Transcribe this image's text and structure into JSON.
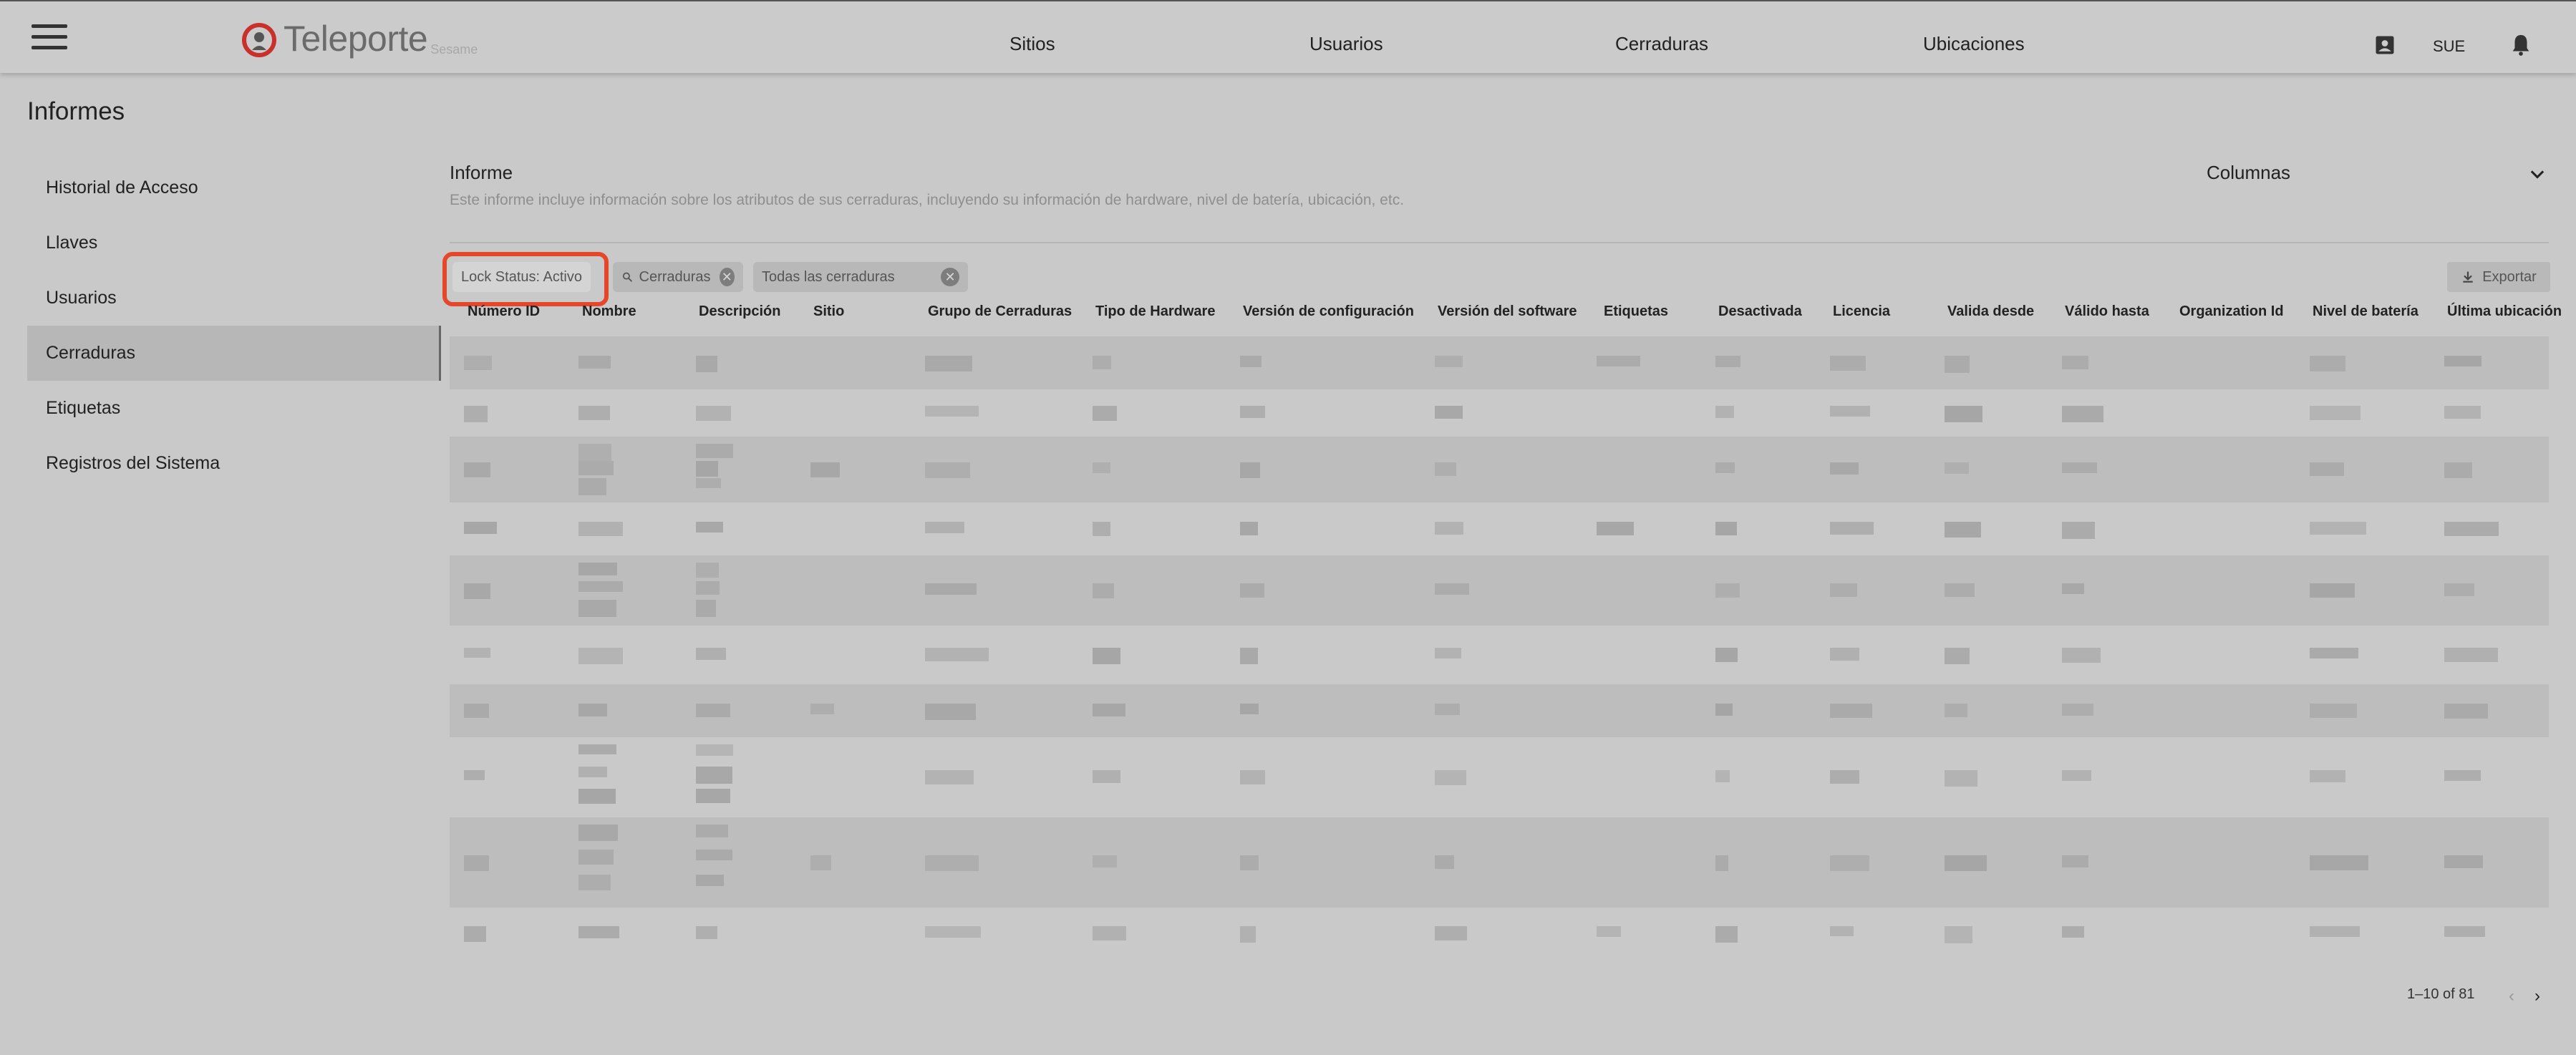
{
  "header": {
    "brand_name": "Teleporte",
    "brand_sub": "Sesame",
    "nav": [
      "Sitios",
      "Usuarios",
      "Cerraduras",
      "Ubicaciones"
    ],
    "user": "SUE"
  },
  "page": {
    "title": "Informes"
  },
  "sidebar": {
    "items": [
      {
        "label": "Historial de Acceso"
      },
      {
        "label": "Llaves"
      },
      {
        "label": "Usuarios"
      },
      {
        "label": "Cerraduras"
      },
      {
        "label": "Etiquetas"
      },
      {
        "label": "Registros del Sistema"
      }
    ],
    "active": "Cerraduras"
  },
  "report": {
    "heading": "Informe",
    "description": "Este informe incluye información sobre los atributos de sus cerraduras, incluyendo su información de hardware, nivel de batería, ubicación, etc.",
    "columns_label": "Columnas"
  },
  "filters": {
    "lock_status": "Lock Status: Activo",
    "search_value": "Cerraduras",
    "scope": "Todas las cerraduras"
  },
  "export_label": "Exportar",
  "table": {
    "columns": [
      "Número ID",
      "Nombre",
      "Descripción",
      "Sitio",
      "Grupo de Cerraduras",
      "Tipo de Hardware",
      "Versión de configuración",
      "Versión del software",
      "Etiquetas",
      "Desactivada",
      "Licencia",
      "Valida desde",
      "Válido hasta",
      "Organization Id",
      "Nivel de batería",
      "Última ubicación"
    ],
    "row_count_visible": 10
  },
  "pagination": {
    "range": "1–10 of 81"
  },
  "colors": {
    "highlight": "#e5472a",
    "logo_red": "#c9302c"
  }
}
